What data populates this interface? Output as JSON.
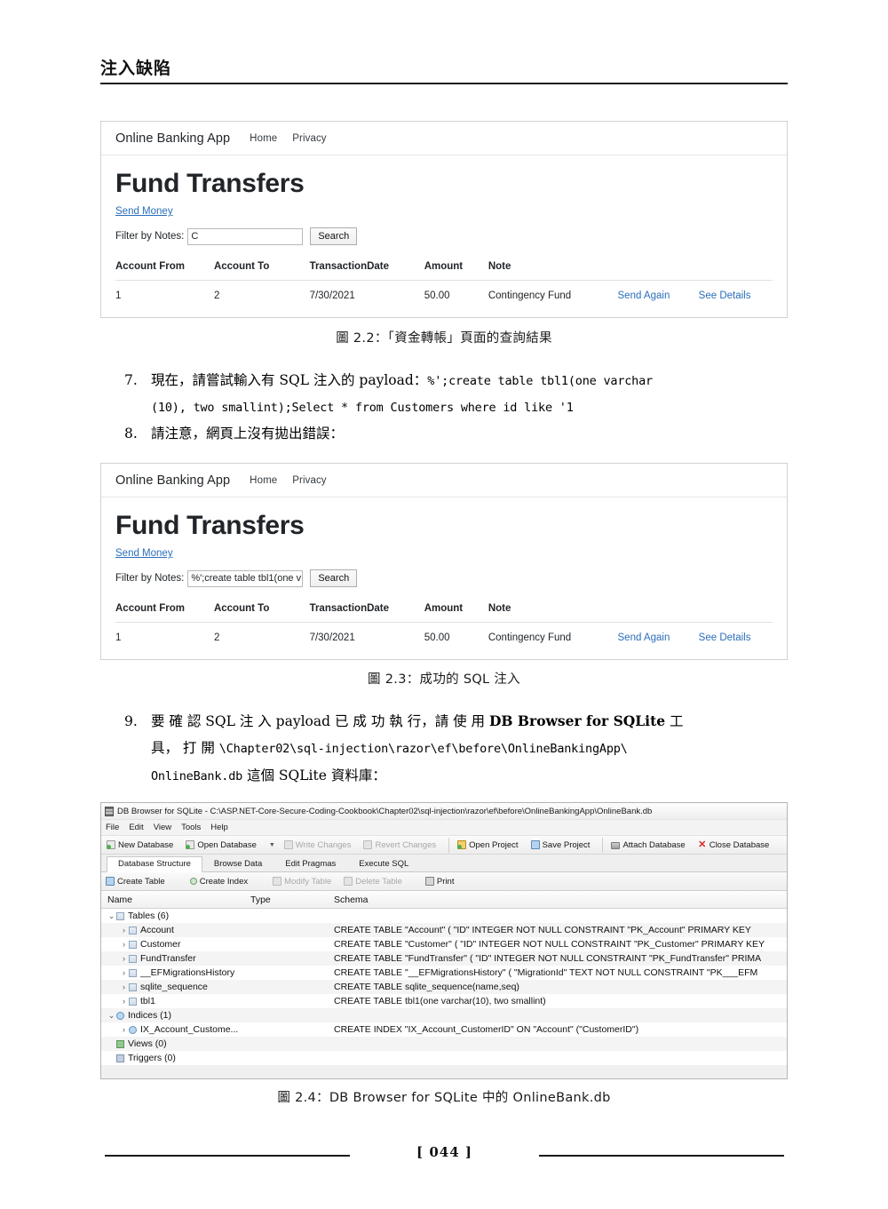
{
  "page": {
    "chapter_title": "注入缺陷",
    "page_number": "[ 044 ]"
  },
  "figure_2_2": {
    "caption": "圖 2.2：「資金轉帳」頁面的查詢結果",
    "navbar": {
      "brand": "Online Banking App",
      "links": [
        "Home",
        "Privacy"
      ]
    },
    "heading": "Fund Transfers",
    "send_money_link": "Send Money",
    "filter_label": "Filter by Notes:",
    "filter_value": "C",
    "search_button": "Search",
    "table": {
      "headers": [
        "Account From",
        "Account To",
        "TransactionDate",
        "Amount",
        "Note",
        "",
        ""
      ],
      "rows": [
        {
          "account_from": "1",
          "account_to": "2",
          "transaction_date": "7/30/2021",
          "amount": "50.00",
          "note": "Contingency Fund",
          "send_again": "Send Again",
          "see_details": "See Details"
        }
      ]
    }
  },
  "figure_2_3": {
    "caption": "圖 2.3：成功的 SQL 注入",
    "navbar": {
      "brand": "Online Banking App",
      "links": [
        "Home",
        "Privacy"
      ]
    },
    "heading": "Fund Transfers",
    "send_money_link": "Send Money",
    "filter_label": "Filter by Notes:",
    "filter_value": "%';create table tbl1(one v",
    "search_button": "Search",
    "table": {
      "headers": [
        "Account From",
        "Account To",
        "TransactionDate",
        "Amount",
        "Note",
        "",
        ""
      ],
      "rows": [
        {
          "account_from": "1",
          "account_to": "2",
          "transaction_date": "7/30/2021",
          "amount": "50.00",
          "note": "Contingency Fund",
          "send_again": "Send Again",
          "see_details": "See Details"
        }
      ]
    }
  },
  "steps": {
    "step7_num": "7.",
    "step7_line1_a": "現在，請嘗試輸入有 SQL 注入的 payload：",
    "step7_line1_code": "%';create table tbl1(one varchar",
    "step7_line2_code": "(10), two smallint);Select * from Customers where id like '1",
    "step7_line2_end": "。",
    "step8_num": "8.",
    "step8_text": "請注意，網頁上沒有拋出錯誤：",
    "step9_num": "9.",
    "step9_line1_a": "要 確 認 SQL 注 入 payload 已 成 功 執 行，請 使 用 ",
    "step9_line1_bold": "DB Browser for SQLite",
    "step9_line1_b": " 工",
    "step9_line2_a": "具， 打 開 ",
    "step9_line2_code": "\\Chapter02\\sql-injection\\razor\\ef\\before\\OnlineBankingApp\\",
    "step9_line3_code": "OnlineBank.db",
    "step9_line3_b": " 這個 SQLite 資料庫："
  },
  "figure_2_4": {
    "caption": "圖 2.4：DB Browser for SQLite 中的 OnlineBank.db",
    "title_bar": "DB Browser for SQLite - C:\\ASP.NET-Core-Secure-Coding-Cookbook\\Chapter02\\sql-injection\\razor\\ef\\before\\OnlineBankingApp\\OnlineBank.db",
    "menu": [
      "File",
      "Edit",
      "View",
      "Tools",
      "Help"
    ],
    "toolbar": [
      {
        "label": "New Database",
        "icon": "new-database-icon",
        "disabled": false
      },
      {
        "label": "Open Database",
        "icon": "open-database-icon",
        "disabled": false
      },
      {
        "label": "Write Changes",
        "icon": "write-changes-icon",
        "disabled": true
      },
      {
        "label": "Revert Changes",
        "icon": "revert-changes-icon",
        "disabled": true
      },
      {
        "label": "Open Project",
        "icon": "open-project-icon",
        "disabled": false
      },
      {
        "label": "Save Project",
        "icon": "save-project-icon",
        "disabled": false
      },
      {
        "label": "Attach Database",
        "icon": "attach-database-icon",
        "disabled": false
      },
      {
        "label": "Close Database",
        "icon": "close-database-icon",
        "disabled": false
      }
    ],
    "tabs": [
      {
        "label": "Database Structure",
        "active": true
      },
      {
        "label": "Browse Data",
        "active": false
      },
      {
        "label": "Edit Pragmas",
        "active": false
      },
      {
        "label": "Execute SQL",
        "active": false
      }
    ],
    "toolbar2": [
      {
        "label": "Create Table",
        "icon": "create-table-icon",
        "disabled": false
      },
      {
        "label": "Create Index",
        "icon": "create-index-icon",
        "disabled": false
      },
      {
        "label": "Modify Table",
        "icon": "modify-table-icon",
        "disabled": true
      },
      {
        "label": "Delete Table",
        "icon": "delete-table-icon",
        "disabled": true
      },
      {
        "label": "Print",
        "icon": "print-icon",
        "disabled": false
      }
    ],
    "tree_headers": {
      "name": "Name",
      "type": "Type",
      "schema": "Schema"
    },
    "tree": [
      {
        "depth": 0,
        "expander": "expanded",
        "icon": "tables-folder-icon",
        "name": "Tables (6)",
        "schema": ""
      },
      {
        "depth": 1,
        "expander": "collapsed",
        "icon": "table-icon",
        "name": "Account",
        "schema": "CREATE TABLE \"Account\" ( \"ID\" INTEGER NOT NULL CONSTRAINT \"PK_Account\" PRIMARY KEY"
      },
      {
        "depth": 1,
        "expander": "collapsed",
        "icon": "table-icon",
        "name": "Customer",
        "schema": "CREATE TABLE \"Customer\" ( \"ID\" INTEGER NOT NULL CONSTRAINT \"PK_Customer\" PRIMARY KEY"
      },
      {
        "depth": 1,
        "expander": "collapsed",
        "icon": "table-icon",
        "name": "FundTransfer",
        "schema": "CREATE TABLE \"FundTransfer\" ( \"ID\" INTEGER NOT NULL CONSTRAINT \"PK_FundTransfer\" PRIMA"
      },
      {
        "depth": 1,
        "expander": "collapsed",
        "icon": "table-icon",
        "name": "__EFMigrationsHistory",
        "schema": "CREATE TABLE \"__EFMigrationsHistory\" ( \"MigrationId\" TEXT NOT NULL CONSTRAINT \"PK___EFM"
      },
      {
        "depth": 1,
        "expander": "collapsed",
        "icon": "table-icon",
        "name": "sqlite_sequence",
        "schema": "CREATE TABLE sqlite_sequence(name,seq)"
      },
      {
        "depth": 1,
        "expander": "collapsed",
        "icon": "table-icon",
        "name": "tbl1",
        "schema": "CREATE TABLE tbl1(one varchar(10), two smallint)"
      },
      {
        "depth": 0,
        "expander": "expanded",
        "icon": "indices-folder-icon",
        "name": "Indices (1)",
        "schema": ""
      },
      {
        "depth": 1,
        "expander": "collapsed",
        "icon": "index-icon",
        "name": "IX_Account_Custome...",
        "schema": "CREATE INDEX \"IX_Account_CustomerID\" ON \"Account\" (\"CustomerID\")"
      },
      {
        "depth": 0,
        "expander": "none",
        "icon": "views-folder-icon",
        "name": "Views (0)",
        "schema": ""
      },
      {
        "depth": 0,
        "expander": "none",
        "icon": "triggers-folder-icon",
        "name": "Triggers (0)",
        "schema": ""
      }
    ]
  }
}
